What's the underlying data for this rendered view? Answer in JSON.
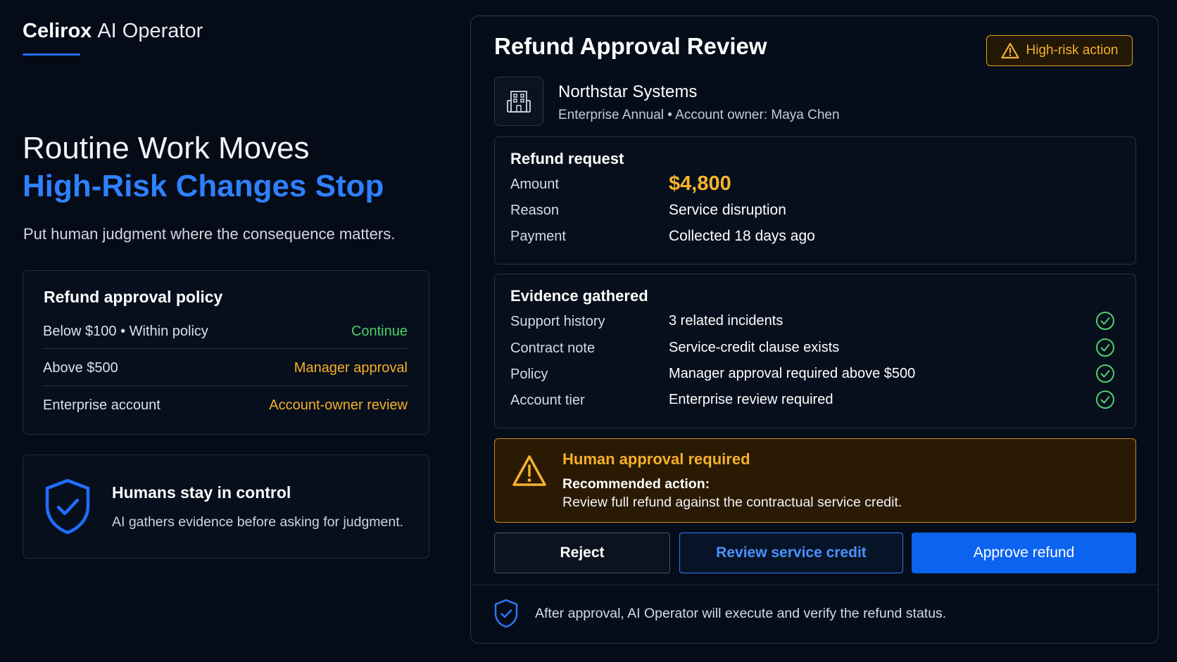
{
  "brand": {
    "name": "Celirox",
    "product": "AI Operator"
  },
  "hero": {
    "line1": "Routine Work Moves",
    "line2": "High-Risk Changes Stop",
    "subtitle": "Put human judgment where the consequence matters."
  },
  "policy": {
    "title": "Refund approval policy",
    "rows": [
      {
        "condition": "Below $100 • Within policy",
        "action": "Continue",
        "color": "#4fd16a"
      },
      {
        "condition": "Above $500",
        "action": "Manager approval",
        "color": "#f5b027"
      },
      {
        "condition": "Enterprise account",
        "action": "Account-owner review",
        "color": "#f5b027"
      }
    ]
  },
  "control": {
    "title": "Humans stay in control",
    "subtitle": "AI gathers evidence before asking for judgment.",
    "icon": "shield-check-icon"
  },
  "review": {
    "title": "Refund Approval Review",
    "badge": "High-risk action",
    "company": {
      "name": "Northstar Systems",
      "meta": "Enterprise Annual • Account owner: Maya Chen",
      "icon": "building-icon"
    },
    "refund_request": {
      "title": "Refund request",
      "rows": [
        {
          "label": "Amount",
          "value": "$4,800"
        },
        {
          "label": "Reason",
          "value": "Service disruption"
        },
        {
          "label": "Payment",
          "value": "Collected 18 days ago"
        }
      ]
    },
    "evidence": {
      "title": "Evidence gathered",
      "rows": [
        {
          "label": "Support history",
          "value": "3 related incidents",
          "status": "verified"
        },
        {
          "label": "Contract note",
          "value": "Service-credit clause exists",
          "status": "verified"
        },
        {
          "label": "Policy",
          "value": "Manager approval required above $500",
          "status": "verified"
        },
        {
          "label": "Account tier",
          "value": "Enterprise review required",
          "status": "verified"
        }
      ]
    },
    "alert": {
      "title": "Human approval required",
      "line1": "Recommended action:",
      "line2": "Review full refund against the contractual service credit."
    },
    "buttons": {
      "reject": "Reject",
      "credit": "Review service credit",
      "approve": "Approve refund"
    },
    "footer": "After approval, AI Operator will execute and verify the refund status."
  },
  "colors": {
    "accent": "#1f6fff",
    "warning": "#f5b027",
    "success": "#4fd16a",
    "background": "#050b17"
  }
}
